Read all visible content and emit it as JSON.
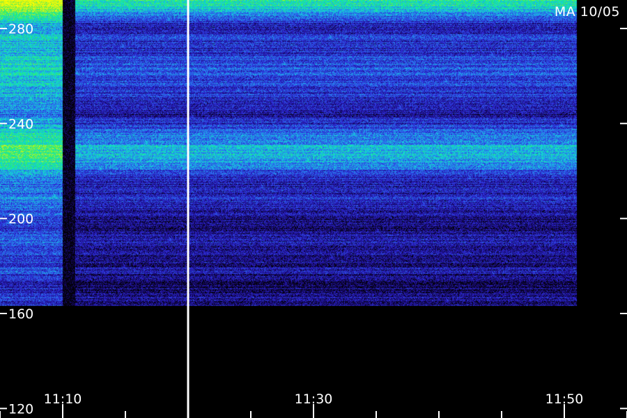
{
  "chart_data": {
    "type": "heatmap",
    "title": "MA 10/05",
    "xlabel": "",
    "ylabel": "",
    "x_tick_labels": [
      "11:10",
      "11:30",
      "11:50"
    ],
    "x_ticks_min": [
      1110,
      1130,
      1150
    ],
    "x_minor_step_min": 5,
    "xlim": [
      "11:05",
      "11:55"
    ],
    "y_tick_labels": [
      "280",
      "240",
      "200",
      "160",
      "120"
    ],
    "y_ticks": [
      280,
      240,
      200,
      160,
      120
    ],
    "ylim": [
      116,
      292
    ],
    "data_end_y": 163,
    "colormap": [
      "#05021a",
      "#1a0a7a",
      "#2e2ad8",
      "#2a7cf0",
      "#10d8d8",
      "#22f070",
      "#c8f020",
      "#ffff00"
    ],
    "bright_region_end": "11:10",
    "gap": [
      "11:10",
      "11:11"
    ],
    "marker_line": "11:20",
    "data_end": "11:51",
    "band_intensity": [
      {
        "y": 290,
        "level": 0.62
      },
      {
        "y": 287,
        "level": 0.52
      },
      {
        "y": 284,
        "level": 0.3
      },
      {
        "y": 280,
        "level": 0.22
      },
      {
        "y": 276,
        "level": 0.32
      },
      {
        "y": 272,
        "level": 0.25
      },
      {
        "y": 268,
        "level": 0.3
      },
      {
        "y": 262,
        "level": 0.36
      },
      {
        "y": 256,
        "level": 0.3
      },
      {
        "y": 250,
        "level": 0.26
      },
      {
        "y": 244,
        "level": 0.18
      },
      {
        "y": 240,
        "level": 0.3
      },
      {
        "y": 234,
        "level": 0.44
      },
      {
        "y": 228,
        "level": 0.56
      },
      {
        "y": 223,
        "level": 0.48
      },
      {
        "y": 219,
        "level": 0.3
      },
      {
        "y": 214,
        "level": 0.22
      },
      {
        "y": 208,
        "level": 0.28
      },
      {
        "y": 202,
        "level": 0.18
      },
      {
        "y": 196,
        "level": 0.14
      },
      {
        "y": 190,
        "level": 0.24
      },
      {
        "y": 184,
        "level": 0.17
      },
      {
        "y": 178,
        "level": 0.2
      },
      {
        "y": 172,
        "level": 0.14
      },
      {
        "y": 166,
        "level": 0.17
      },
      {
        "y": 163,
        "level": 0.15
      }
    ]
  }
}
